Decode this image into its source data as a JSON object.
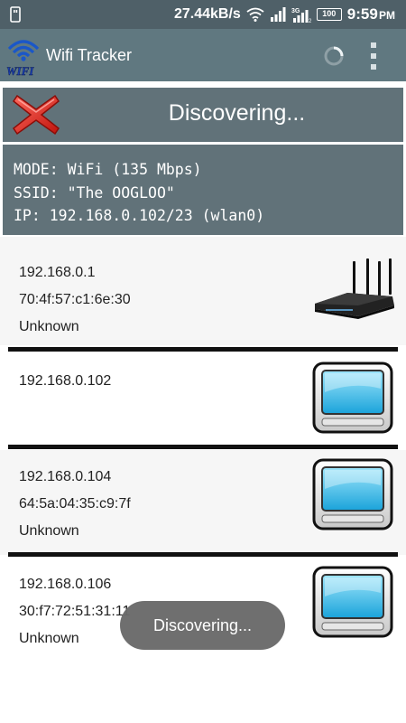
{
  "status_bar": {
    "speed": "27.44kB/s",
    "battery": "100",
    "time": "9:59",
    "ampm": "PM",
    "icons": [
      "usb-icon",
      "wifi-icon",
      "signal-icon",
      "3g-signal-icon",
      "battery-icon"
    ]
  },
  "app": {
    "title": "Wifi Tracker",
    "logo_text": "WIFI"
  },
  "header": {
    "status": "Discovering..."
  },
  "info": {
    "mode": "MODE: WiFi (135 Mbps)",
    "ssid": "SSID: \"The OOGLOO\"",
    "ip": "IP: 192.168.0.102/23 (wlan0)"
  },
  "devices": [
    {
      "ip": "192.168.0.1",
      "mac": "70:4f:57:c1:6e:30",
      "vendor": "Unknown",
      "icon": "router-icon"
    },
    {
      "ip": "192.168.0.102",
      "icon": "computer-icon"
    },
    {
      "ip": "192.168.0.104",
      "mac": "64:5a:04:35:c9:7f",
      "vendor": "Unknown",
      "icon": "computer-icon"
    },
    {
      "ip": "192.168.0.106",
      "mac": "30:f7:72:51:31:11",
      "vendor": "Unknown",
      "icon": "computer-icon"
    }
  ],
  "toast": {
    "message": "Discovering..."
  },
  "colors": {
    "status_bar": "#4f6068",
    "action_bar": "#607880",
    "panel": "#617279",
    "cancel": "#e0261d"
  }
}
